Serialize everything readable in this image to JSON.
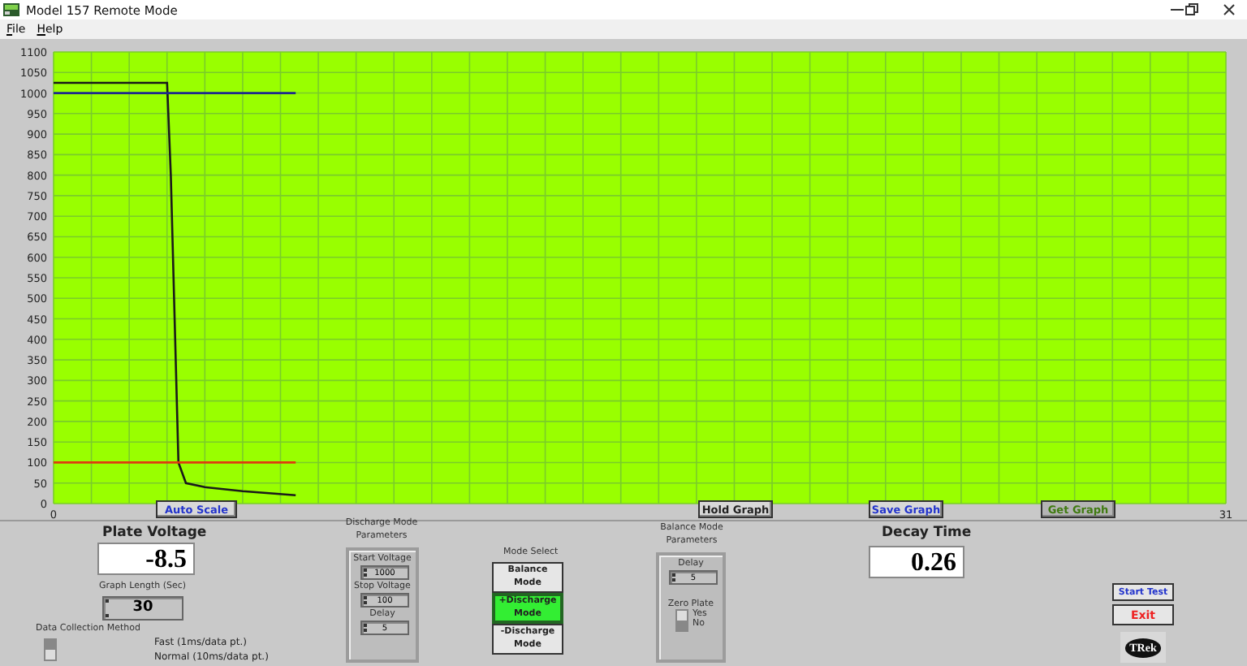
{
  "window": {
    "title": "Model 157 Remote Mode"
  },
  "menu": [
    "File",
    "Help"
  ],
  "graph": {
    "chart_data": {
      "type": "line",
      "grid": true,
      "x": [
        0,
        3.0,
        3.1,
        3.3,
        3.5,
        4,
        5,
        6.4
      ],
      "xlim": [
        0,
        31
      ],
      "ylim": [
        0,
        1100
      ],
      "xticks": [
        0,
        31
      ],
      "yticks": [
        0,
        50,
        100,
        150,
        200,
        250,
        300,
        350,
        400,
        450,
        500,
        550,
        600,
        650,
        700,
        750,
        800,
        850,
        900,
        950,
        1000,
        1050,
        1100
      ],
      "series": [
        {
          "color": "#1a1a1a",
          "values": [
            1025,
            1025,
            800,
            100,
            50,
            40,
            30,
            20
          ]
        },
        {
          "color": "#1f2a8c",
          "values": [
            1000,
            1000,
            1000,
            1000,
            1000,
            1000,
            1000,
            1000
          ]
        },
        {
          "color": "#e03a10",
          "values": [
            100,
            100,
            100,
            100,
            100,
            100,
            100,
            100
          ]
        }
      ]
    },
    "buttons": [
      {
        "label": "Auto Scale",
        "disabled": false
      },
      {
        "label": "Hold Graph",
        "disabled": false
      },
      {
        "label": "Save Graph",
        "disabled": false
      },
      {
        "label": "Get Graph",
        "disabled": true
      }
    ]
  },
  "plate_voltage": {
    "label": "Plate Voltage",
    "value": "-8.5"
  },
  "graph_length": {
    "label": "Graph Length (Sec)",
    "value": "30"
  },
  "data_collection": {
    "label": "Data Collection Method",
    "options": [
      {
        "label": "Fast (1ms/data pt.)",
        "selected": true
      },
      {
        "label": "Normal (10ms/data pt.)",
        "selected": false
      }
    ]
  },
  "discharge_params": {
    "title": "Discharge Mode Parameters",
    "fields": [
      {
        "label": "Start Voltage",
        "value": "1000"
      },
      {
        "label": "Stop Voltage",
        "value": "100"
      },
      {
        "label": "Delay",
        "value": "5"
      }
    ]
  },
  "mode_select": {
    "label": "Mode Select",
    "modes": [
      {
        "label": "Balance Mode",
        "selected": false
      },
      {
        "label": "+Discharge Mode",
        "selected": true
      },
      {
        "label": "-Discharge Mode",
        "selected": false
      }
    ]
  },
  "balance_params": {
    "title": "Balance Mode Parameters",
    "delay": {
      "label": "Delay",
      "value": "5"
    },
    "zero_plate": {
      "label": "Zero Plate",
      "options": [
        {
          "label": "Yes",
          "selected": false
        },
        {
          "label": "No",
          "selected": true
        }
      ]
    }
  },
  "decay_time": {
    "label": "Decay Time",
    "value": "0.26"
  },
  "actions": [
    {
      "label": "Start Test",
      "kind": "start"
    },
    {
      "label": "Exit",
      "kind": "exit"
    }
  ],
  "logo": "TRek"
}
